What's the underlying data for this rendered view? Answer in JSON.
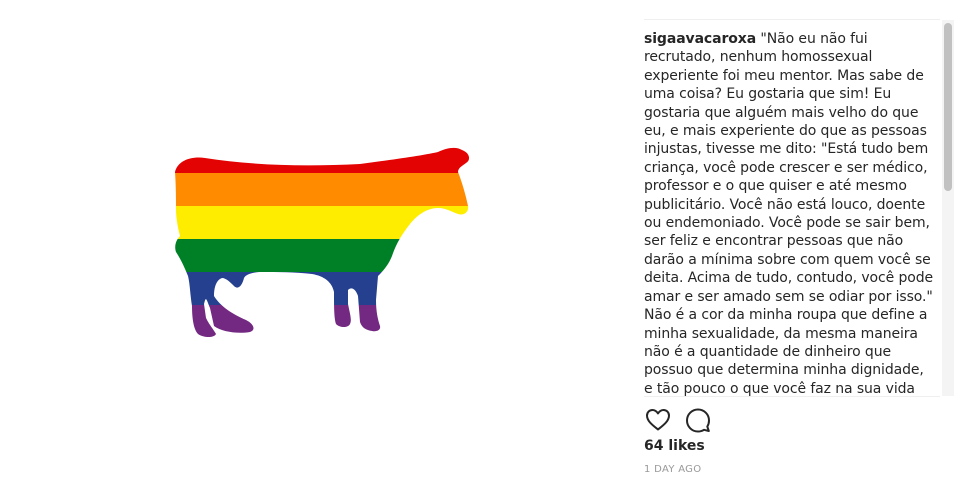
{
  "post": {
    "image": {
      "subject": "cow silhouette",
      "stripe_colors": [
        "#e40303",
        "#ff8c00",
        "#ffed00",
        "#008026",
        "#24408e",
        "#732982"
      ]
    },
    "caption": {
      "username": "sigaavacaroxa",
      "text": " \"Não eu não fui recrutado, nenhum homossexual experiente foi meu mentor. Mas sabe de uma coisa? Eu gostaria que sim! Eu gostaria que alguém mais velho do que eu, e mais experiente do que as pessoas injustas, tivesse me dito: \"Está tudo bem criança, você pode crescer e ser médico, professor e o que quiser e até mesmo publicitário. Você não está louco, doente ou endemoniado. Você pode se sair bem, ser feliz e encontrar pessoas que não darão a mínima sobre com quem você se deita. Acima de tudo, contudo, você pode amar e ser amado sem se odiar por isso.\" Não é a cor da minha roupa que define a minha sexualidade, da mesma maneira não é a quantidade de dinheiro que possuo que determina minha dignidade, e tão pouco o que você faz na sua vida íntima me diz o que você é."
    },
    "actions": {
      "like_icon": "heart-outline",
      "comment_icon": "speech-bubble-outline"
    },
    "likes_label": "64 likes",
    "timestamp": "1 DAY AGO"
  }
}
